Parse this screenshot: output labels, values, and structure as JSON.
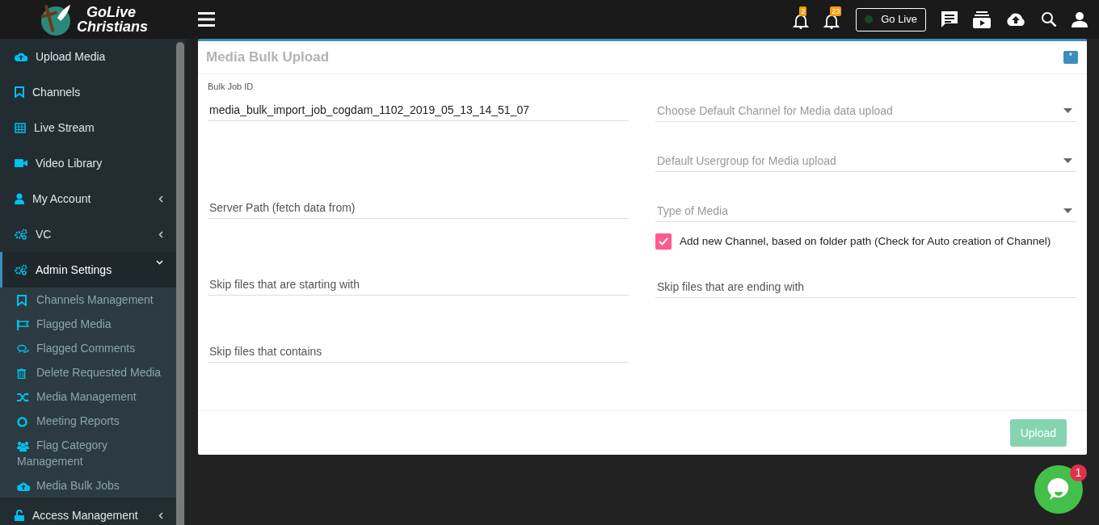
{
  "logo": {
    "line1": "GoLive",
    "line2": "Christians"
  },
  "sidebar": {
    "items": [
      {
        "label": "Upload Media",
        "expanded": false,
        "has_arrow": false
      },
      {
        "label": "Channels",
        "expanded": false,
        "has_arrow": false
      },
      {
        "label": "Live Stream",
        "expanded": false,
        "has_arrow": false
      },
      {
        "label": "Video Library",
        "expanded": false,
        "has_arrow": false
      },
      {
        "label": "My Account",
        "expanded": false,
        "has_arrow": true
      },
      {
        "label": "VC",
        "expanded": false,
        "has_arrow": true
      },
      {
        "label": "Admin Settings",
        "expanded": true,
        "has_arrow": true,
        "children": [
          {
            "label": "Channels Management"
          },
          {
            "label": "Flagged Media"
          },
          {
            "label": "Flagged Comments"
          },
          {
            "label": "Delete Requested Media"
          },
          {
            "label": "Media Management"
          },
          {
            "label": "Meeting Reports"
          },
          {
            "label": "Flag Category Management"
          },
          {
            "label": "Media Bulk Jobs"
          }
        ]
      },
      {
        "label": "Access Management",
        "expanded": false,
        "has_arrow": true
      }
    ]
  },
  "header": {
    "notifications": [
      {
        "count": "2"
      },
      {
        "count": "23"
      }
    ],
    "go_live": "Go Live"
  },
  "card": {
    "title": "Media Bulk Upload",
    "collapse": "*",
    "left_fields": [
      {
        "kind": "input",
        "label": "Bulk Job ID",
        "value": "media_bulk_import_job_cogdam_1102_2019_05_13_14_51_07"
      },
      {
        "kind": "input",
        "placeholder": "Server Path (fetch data from)"
      },
      {
        "kind": "input",
        "placeholder": "Skip files that are starting with"
      },
      {
        "kind": "input",
        "placeholder": "Skip files that contains"
      }
    ],
    "right_fields": [
      {
        "kind": "select",
        "placeholder": "Choose Default Channel for Media data upload"
      },
      {
        "kind": "select",
        "placeholder": "Default Usergroup for Media upload"
      },
      {
        "kind": "select",
        "placeholder": "Type of Media"
      },
      {
        "kind": "checkbox",
        "label": "Add new Channel, based on folder path (Check for Auto creation of Channel)",
        "checked": true
      },
      {
        "kind": "input",
        "placeholder": "Skip files that are ending with"
      }
    ],
    "upload_button": {
      "label": "Upload",
      "disabled": true
    }
  },
  "chat": {
    "badge": "1"
  }
}
